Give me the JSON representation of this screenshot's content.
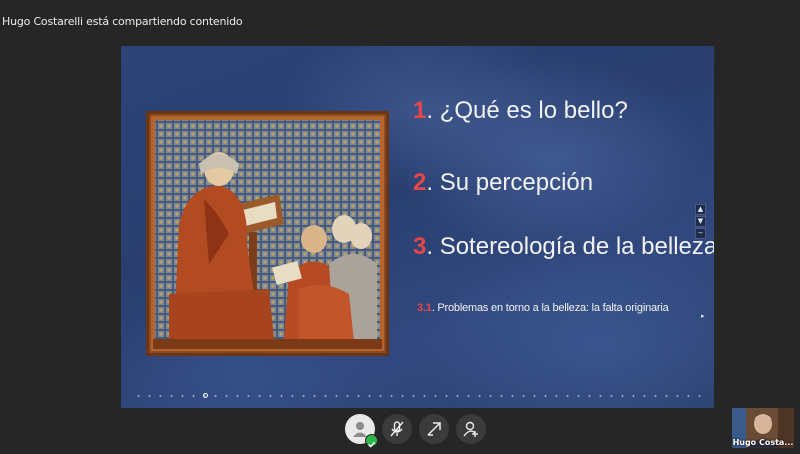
{
  "banner": {
    "text": "Hugo Costarelli está compartiendo contenido"
  },
  "slide": {
    "items": [
      {
        "num": "1",
        "text": ". ¿Qué es lo bello?"
      },
      {
        "num": "2",
        "text": ". Su percepción"
      },
      {
        "num": "3",
        "text": ". Sotereología de la belleza"
      }
    ],
    "subitem": {
      "num": "3.1",
      "text": ". Problemas en torno a la belleza: la falta originaria"
    },
    "nav": {
      "up": "▲",
      "down": "▼",
      "minus": "−"
    },
    "next_arrow": "▸"
  },
  "participant": {
    "name": "Hugo Costa..."
  },
  "icons": {
    "avatar": "user-avatar-icon",
    "mic": "mic-muted-icon",
    "share": "share-screen-icon",
    "add_user": "add-participant-icon"
  },
  "colors": {
    "accent_number": "#e8474a",
    "badge": "#2fb54a"
  }
}
